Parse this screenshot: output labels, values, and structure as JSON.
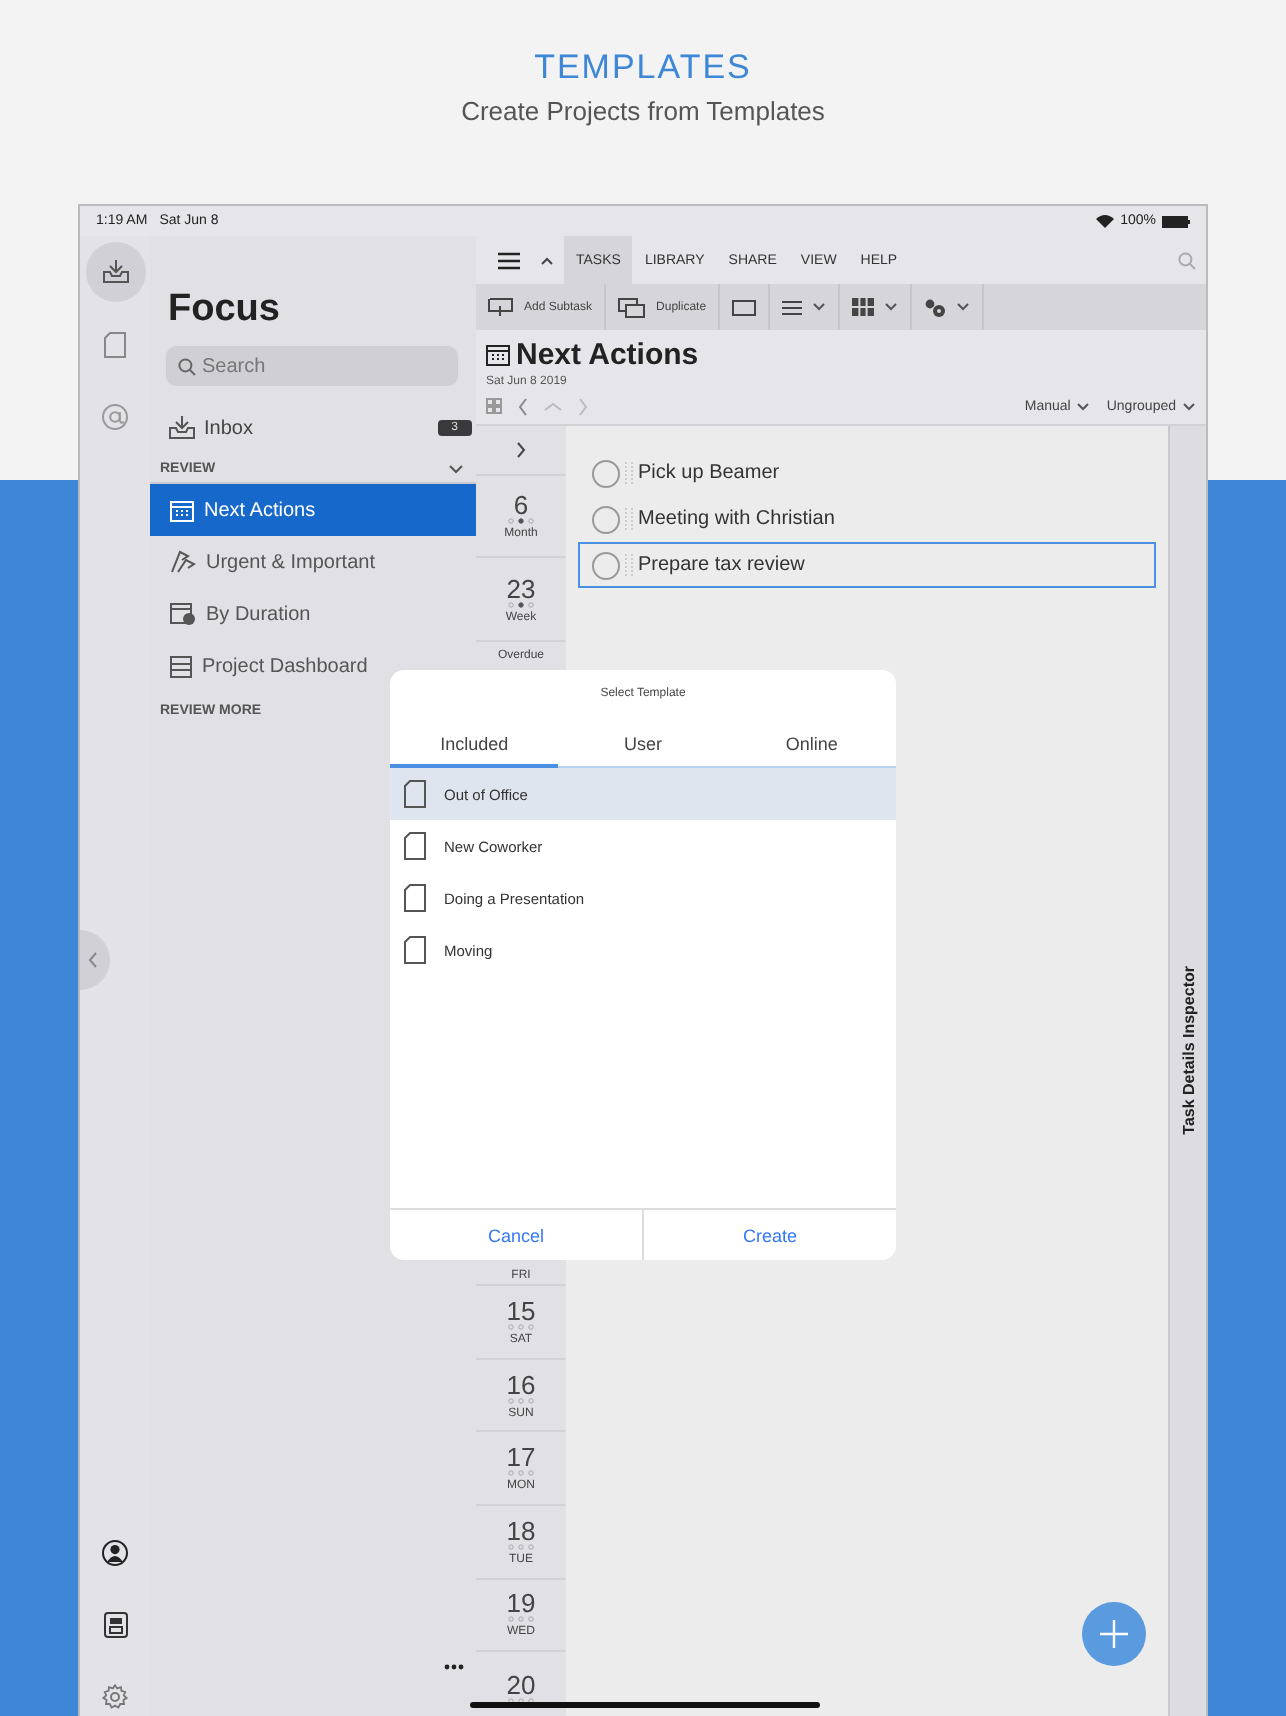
{
  "header": {
    "title": "TEMPLATES",
    "subtitle": "Create Projects from Templates"
  },
  "status_bar": {
    "time": "1:19 AM",
    "date": "Sat Jun 8",
    "battery": "100%"
  },
  "rail": {
    "items": [
      {
        "kind": "inbox",
        "selected": true
      },
      {
        "kind": "document",
        "selected": false
      },
      {
        "kind": "mention",
        "selected": false
      }
    ],
    "bottom": [
      {
        "kind": "person"
      },
      {
        "kind": "sync"
      },
      {
        "kind": "settings"
      }
    ]
  },
  "sidebar": {
    "title": "Focus",
    "search": {
      "placeholder": "Search"
    },
    "inbox": {
      "label": "Inbox",
      "count": "3"
    },
    "section": {
      "label": "REVIEW",
      "expanded": true
    },
    "items": [
      {
        "label": "Next Actions",
        "kind": "calendar",
        "selected": true
      },
      {
        "label": "Urgent & Important",
        "kind": "flags",
        "selected": false
      },
      {
        "label": "By Duration",
        "kind": "duration",
        "selected": false
      },
      {
        "label": "Project Dashboard",
        "kind": "dashboard",
        "selected": false
      }
    ],
    "more": "REVIEW MORE"
  },
  "menu_tabs": [
    {
      "label": "TASKS",
      "selected": true
    },
    {
      "label": "LIBRARY",
      "selected": false
    },
    {
      "label": "SHARE",
      "selected": false
    },
    {
      "label": "VIEW",
      "selected": false
    },
    {
      "label": "HELP",
      "selected": false
    }
  ],
  "toolbar": [
    {
      "kind": "subtask",
      "label": "Add Subtask",
      "dropdown": false
    },
    {
      "kind": "duplicate",
      "label": "Duplicate",
      "dropdown": false
    },
    {
      "kind": "frame",
      "dropdown": false
    },
    {
      "kind": "list",
      "dropdown": true
    },
    {
      "kind": "grid",
      "dropdown": true
    },
    {
      "kind": "gears",
      "dropdown": true
    }
  ],
  "perspective": {
    "title": "Next Actions",
    "date": "Sat Jun 8 2019",
    "sort": "Manual",
    "grouping": "Ungrouped"
  },
  "calendar": {
    "summary": [
      {
        "number": "6",
        "label": "Month"
      },
      {
        "number": "23",
        "label": "Week"
      }
    ],
    "overdue": "Overdue",
    "partial_label": "FRI",
    "days": [
      {
        "number": "15",
        "label": "SAT"
      },
      {
        "number": "16",
        "label": "SUN"
      },
      {
        "number": "17",
        "label": "MON"
      },
      {
        "number": "18",
        "label": "TUE"
      },
      {
        "number": "19",
        "label": "WED"
      },
      {
        "number": "20"
      }
    ]
  },
  "tasks": [
    {
      "title": "Pick up Beamer",
      "selected": false
    },
    {
      "title": "Meeting with Christian",
      "selected": false
    },
    {
      "title": "Prepare tax review",
      "selected": true
    }
  ],
  "inspector": {
    "label": "Task Details Inspector"
  },
  "dialog": {
    "title": "Select Template",
    "tabs": [
      {
        "label": "Included",
        "selected": true
      },
      {
        "label": "User",
        "selected": false
      },
      {
        "label": "Online",
        "selected": false
      }
    ],
    "templates": [
      {
        "name": "Out of Office",
        "selected": true
      },
      {
        "name": "New Coworker",
        "selected": false
      },
      {
        "name": "Doing a Presentation",
        "selected": false
      },
      {
        "name": "Moving",
        "selected": false
      }
    ],
    "cancel": "Cancel",
    "confirm": "Create"
  }
}
